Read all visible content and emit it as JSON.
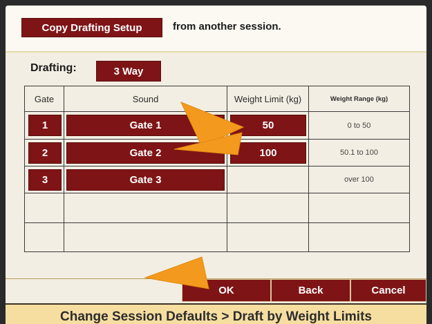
{
  "header": {
    "copy_button_label": "Copy Drafting Setup",
    "copy_suffix_text": "from another session."
  },
  "drafting": {
    "label": "Drafting:",
    "mode": "3 Way"
  },
  "table": {
    "headers": {
      "gate": "Gate",
      "sound": "Sound",
      "weight_limit": "Weight Limit (kg)",
      "weight_range": "Weight Range (kg)"
    },
    "rows": [
      {
        "gate": "1",
        "sound": "Gate 1",
        "weight_limit": "50",
        "weight_range": "0 to 50"
      },
      {
        "gate": "2",
        "sound": "Gate 2",
        "weight_limit": "100",
        "weight_range": "50.1 to 100"
      },
      {
        "gate": "3",
        "sound": "Gate 3",
        "weight_limit": "",
        "weight_range": "over 100"
      }
    ]
  },
  "buttons": {
    "ok": "OK",
    "back": "Back",
    "cancel": "Cancel"
  },
  "status_bar": {
    "text": "Change Session Defaults > Draft by Weight Limits"
  },
  "colors": {
    "button_red": "#7f1416",
    "pointer_orange": "#f39a1e",
    "status_yellow": "#f6dea1"
  }
}
